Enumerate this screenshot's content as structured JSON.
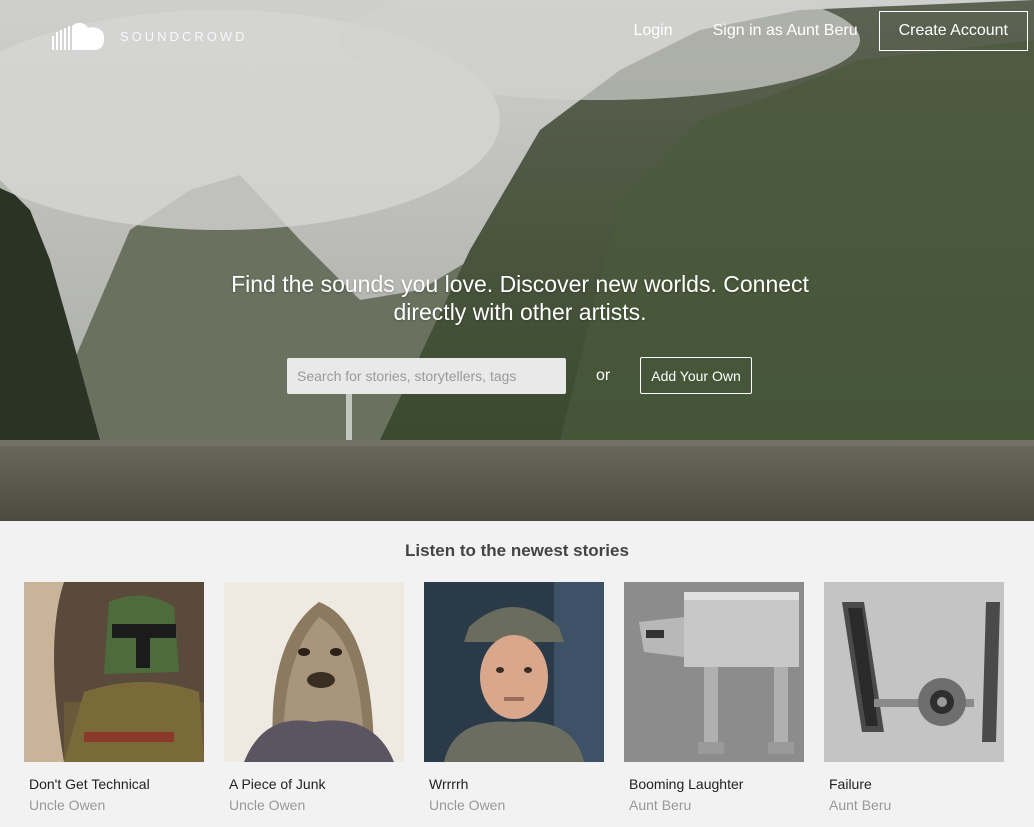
{
  "brand": {
    "name": "SOUNDCROWD",
    "icon": "cloud-logo-icon"
  },
  "nav": {
    "login": "Login",
    "demo_login": "Sign in as Aunt Beru",
    "create_account": "Create Account"
  },
  "hero": {
    "headline": "Find the sounds you love. Discover new worlds. Connect directly with other artists.",
    "search_placeholder": "Search for stories, storytellers, tags",
    "search_value": "",
    "or": "or",
    "add_button": "Add Your Own"
  },
  "stories": {
    "title": "Listen to the newest stories",
    "items": [
      {
        "title": "Don't Get Technical",
        "author": "Uncle Owen"
      },
      {
        "title": "A Piece of Junk",
        "author": "Uncle Owen"
      },
      {
        "title": "Wrrrrh",
        "author": "Uncle Owen"
      },
      {
        "title": "Booming Laughter",
        "author": "Aunt Beru"
      },
      {
        "title": "Failure",
        "author": "Aunt Beru"
      }
    ]
  }
}
